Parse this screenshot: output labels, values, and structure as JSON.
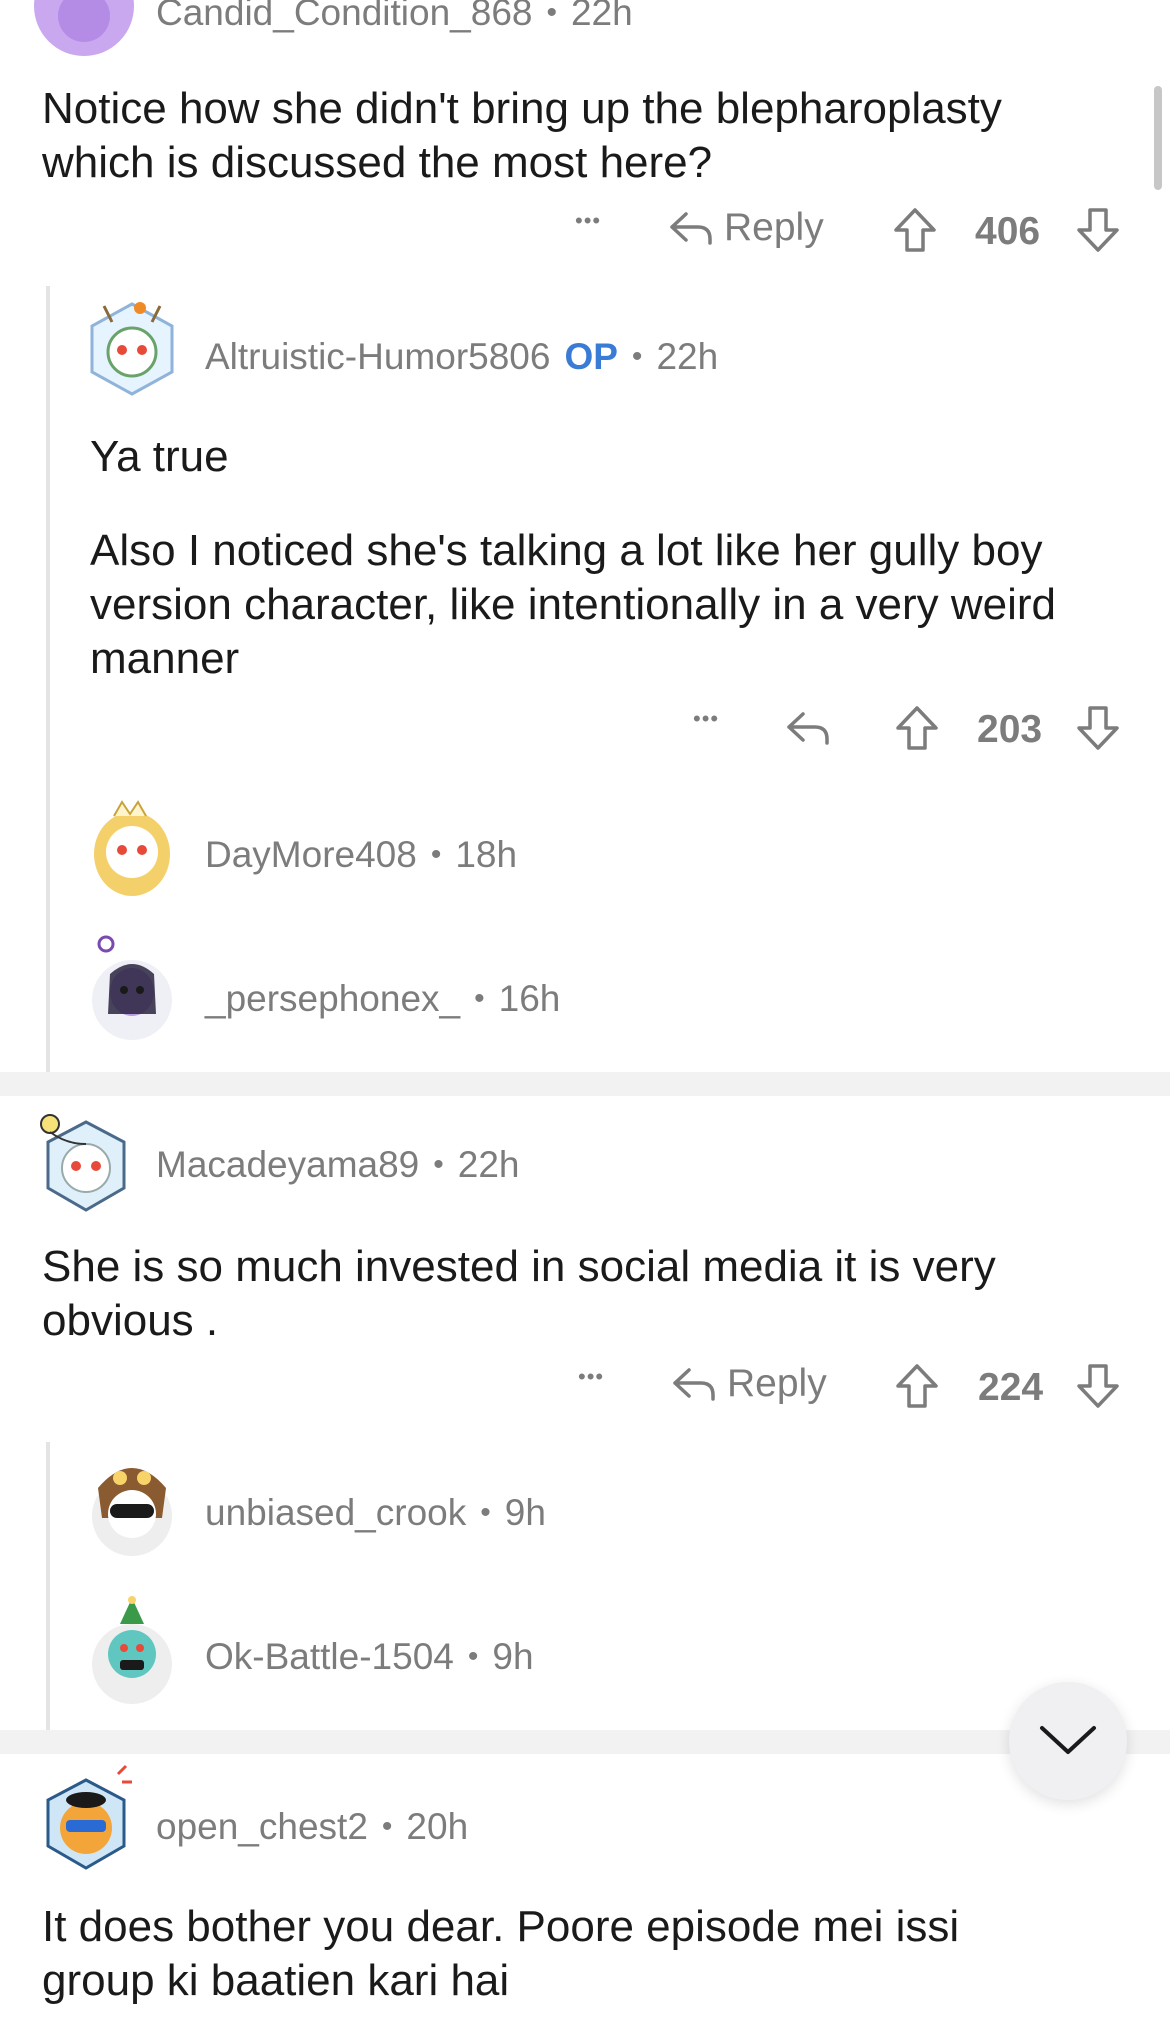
{
  "comments": [
    {
      "username": "Candid_Condition_868",
      "time": "22h",
      "text": "Notice how she didn't bring up the blepharoplasty which is discussed the most here?",
      "reply_label": "Reply",
      "score": "406",
      "avatar_color": "#c9a8f0"
    },
    {
      "username": "Altruistic-Humor5806",
      "op_badge": "OP",
      "time": "22h",
      "text_line1": "Ya true",
      "text_line2": "Also I noticed she's talking a lot like her gully boy version character, like intentionally in a very weird manner",
      "score": "203"
    },
    {
      "username": "DayMore408",
      "time": "18h"
    },
    {
      "username": "_persephonex_",
      "time": "16h"
    },
    {
      "username": "Macadeyama89",
      "time": "22h",
      "text": "She is so much invested in social media it is very obvious .",
      "reply_label": "Reply",
      "score": "224"
    },
    {
      "username": "unbiased_crook",
      "time": "9h"
    },
    {
      "username": "Ok-Battle-1504",
      "time": "9h"
    },
    {
      "username": "open_chest2",
      "time": "20h",
      "text": "It does bother you dear. Poore episode mei issi group ki baatien kari hai"
    }
  ],
  "dot_separator": "•",
  "more_dots": "•••",
  "icons": {
    "reply": "reply-arrow-icon",
    "upvote": "upvote-arrow-icon",
    "downvote": "downvote-arrow-icon",
    "collapse": "chevron-down-icon"
  },
  "colors": {
    "op": "#3a7bd5",
    "meta": "#7c7c7c",
    "separator": "#f2f2f2"
  }
}
